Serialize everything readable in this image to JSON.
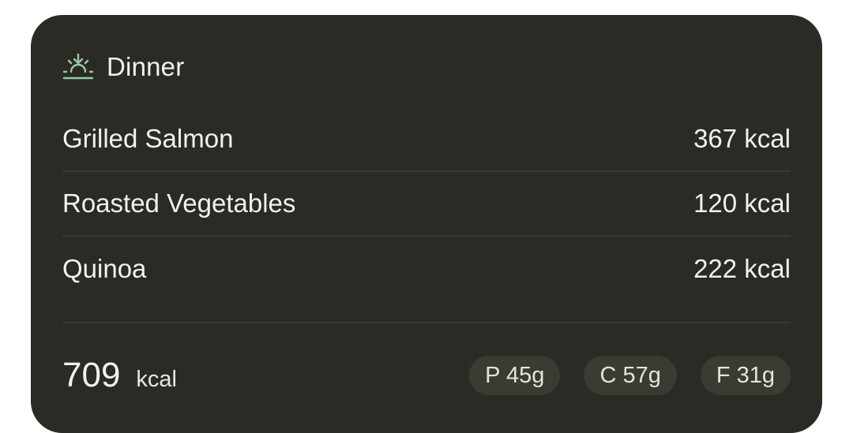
{
  "header": {
    "icon": "sunset-icon",
    "title": "Dinner"
  },
  "items": [
    {
      "name": "Grilled Salmon",
      "kcal": "367 kcal"
    },
    {
      "name": "Roasted Vegetables",
      "kcal": "120 kcal"
    },
    {
      "name": "Quinoa",
      "kcal": "222 kcal"
    }
  ],
  "footer": {
    "total": "709",
    "unit": "kcal",
    "macros": {
      "protein": "P 45g",
      "carbs": "C 57g",
      "fat": "F 31g"
    }
  },
  "colors": {
    "card_bg": "#2b2a24",
    "accent": "#9cc7a6",
    "text": "#f2f1ec"
  }
}
